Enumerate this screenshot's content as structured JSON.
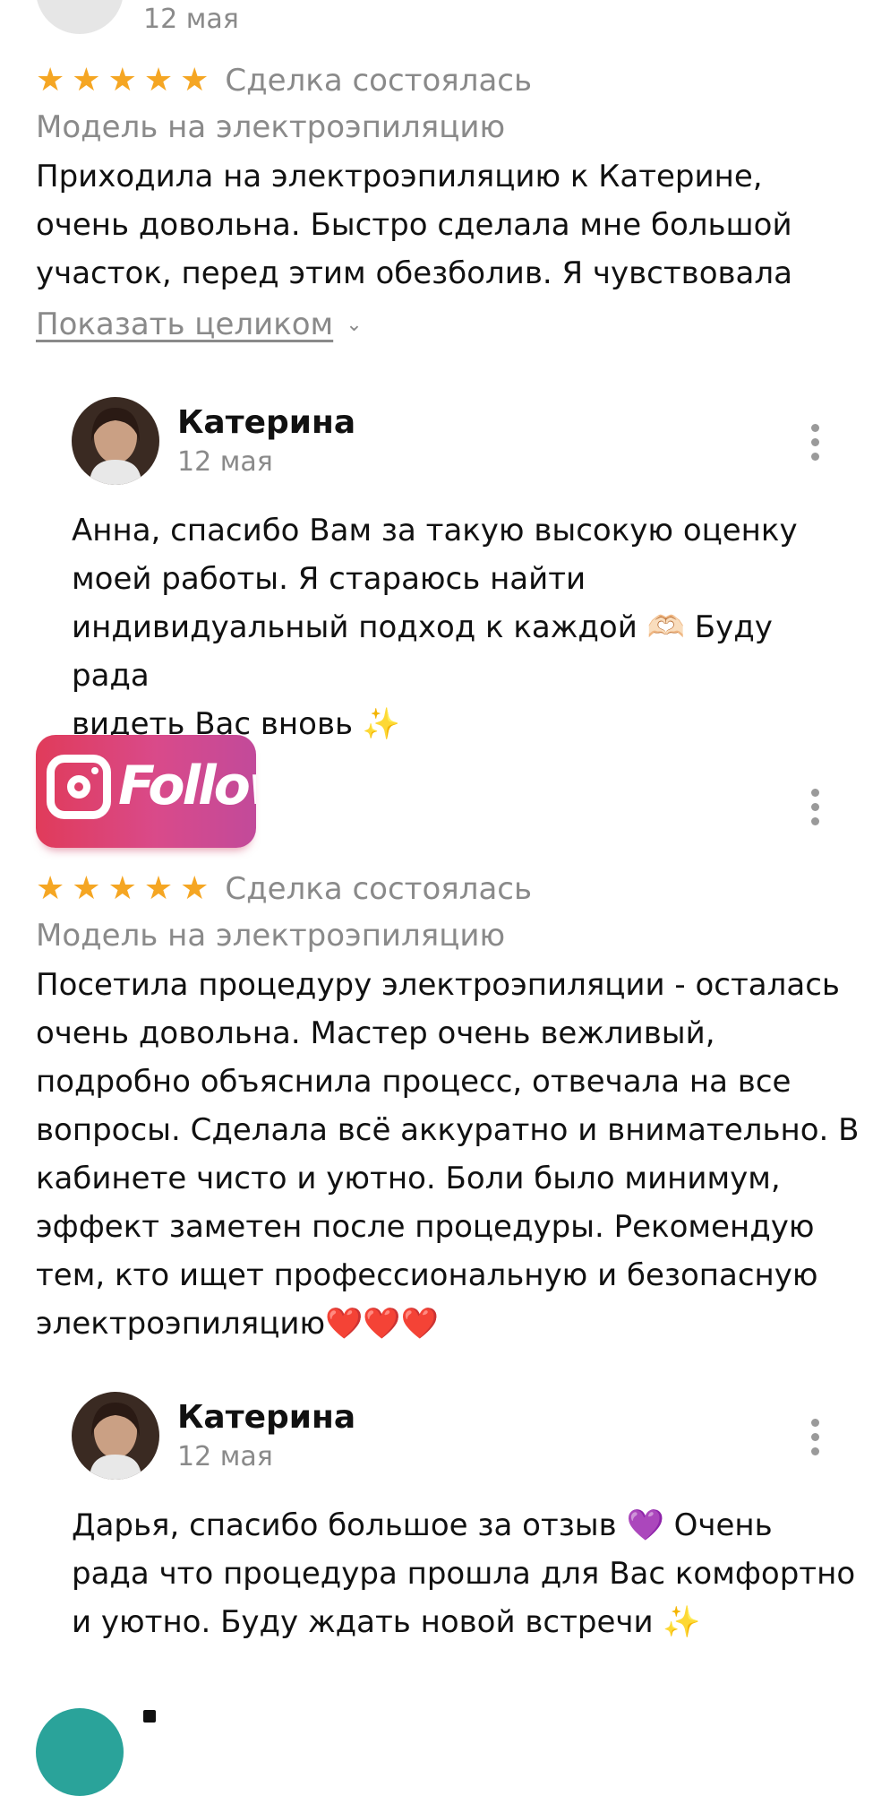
{
  "review1": {
    "date": "12 мая",
    "deal_status": "Сделка состоялась",
    "category": "Модель на электроэпиляцию",
    "text_lines": [
      "Приходила на электроэпиляцию к Катерине,",
      "очень довольна. Быстро сделала мне большой",
      "участок, перед этим обезболив. Я чувствовала"
    ],
    "show_full_label": "Показать целиком",
    "rating": 5
  },
  "reply1": {
    "author": "Катерина",
    "date": "12 мая",
    "lines": [
      "Анна, спасибо Вам за такую высокую оценку",
      "моей работы. Я стараюсь найти",
      "индивидуальный подход к каждой 🫶🏻 Буду рада",
      "видеть Вас вновь ✨"
    ]
  },
  "review2": {
    "reviewer_logo_text": "Follow",
    "deal_status": "Сделка состоялась",
    "category": "Модель на электроэпиляцию",
    "rating": 5,
    "text_lines": [
      "Посетила процедуру электроэпиляции - осталась",
      "очень довольна. Мастер очень вежливый,",
      "подробно объяснила процесс, отвечала на все",
      "вопросы. Сделала всё аккуратно и внимательно. В",
      "кабинете чисто и уютно.  Боли было минимум,",
      "эффект заметен после  процедуры. Рекомендую",
      "тем, кто ищет профессиональную и безопасную",
      "электроэпиляцию❤️❤️❤️"
    ]
  },
  "reply2": {
    "author": "Катерина",
    "date": "12 мая",
    "lines": [
      "Дарья, спасибо большое за отзыв 💜 Очень",
      "рада что процедура прошла для Вас комфортно",
      "и уютно. Буду ждать новой встречи ✨"
    ]
  },
  "colors": {
    "star": "#f5a623",
    "muted_text": "#8a8a8a",
    "next_avatar": "#2aa39a"
  },
  "icons": [
    "star-icon",
    "more-vertical-icon",
    "chevron-down-icon",
    "instagram-icon"
  ]
}
